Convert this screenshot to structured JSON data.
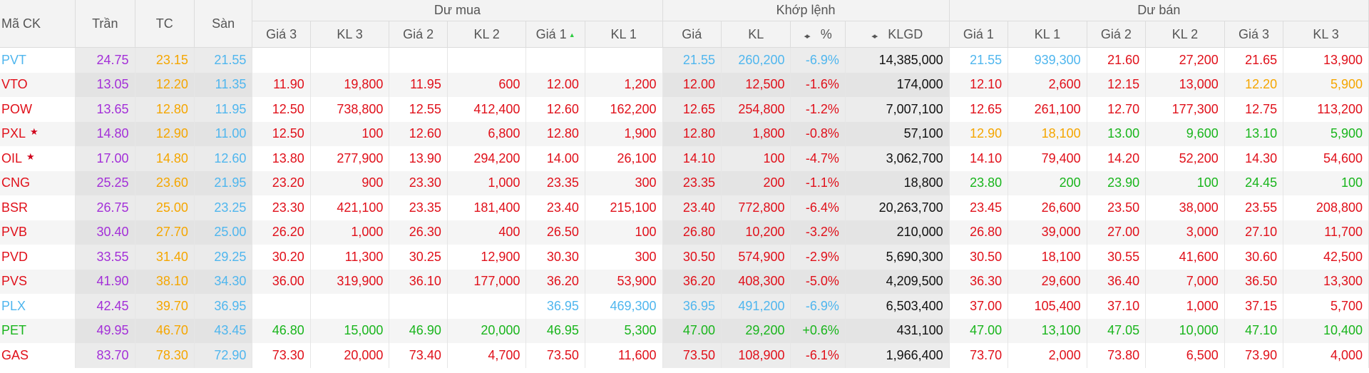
{
  "colors": {
    "ceil": "#a32fd8",
    "ref": "#f5a600",
    "floor": "#4fb6ee",
    "down": "#e0101a",
    "up": "#19b51c",
    "neutral": "#111111"
  },
  "icons": {
    "sort": "sort-up-triangle-icon",
    "toggle": "left-right-arrows-icon",
    "star": "star-icon"
  },
  "header": {
    "symbol": "Mã CK",
    "ceil": "Trần",
    "ref": "TC",
    "floor": "Sàn",
    "buy_group": "Dư mua",
    "match_group": "Khớp lệnh",
    "sell_group": "Dư bán",
    "buy_p3": "Giá 3",
    "buy_v3": "KL 3",
    "buy_p2": "Giá 2",
    "buy_v2": "KL 2",
    "buy_p1": "Giá 1",
    "buy_v1": "KL 1",
    "m_price": "Giá",
    "m_vol": "KL",
    "m_pct": "%",
    "m_total": "KLGD",
    "sell_p1": "Giá 1",
    "sell_v1": "KL 1",
    "sell_p2": "Giá 2",
    "sell_v2": "KL 2",
    "sell_p3": "Giá 3",
    "sell_v3": "KL 3"
  },
  "rows": [
    {
      "sym": "PVT",
      "symc": "blue",
      "star": false,
      "ceil": "24.75",
      "ref": "23.15",
      "floor": "21.55",
      "bp3": "",
      "bp3c": "red",
      "bv3": "",
      "bp2": "",
      "bp2c": "red",
      "bv2": "",
      "bp1": "",
      "bp1c": "red",
      "bv1": "",
      "mp": "21.55",
      "mpc": "blue",
      "mv": "260,200",
      "pct": "-6.9%",
      "total": "14,385,000",
      "sp1": "21.55",
      "sp1c": "blue",
      "sv1": "939,300",
      "sp2": "21.60",
      "sp2c": "red",
      "sv2": "27,200",
      "sp3": "21.65",
      "sp3c": "red",
      "sv3": "13,900"
    },
    {
      "sym": "VTO",
      "symc": "red",
      "star": false,
      "ceil": "13.05",
      "ref": "12.20",
      "floor": "11.35",
      "bp3": "11.90",
      "bp3c": "red",
      "bv3": "19,800",
      "bp2": "11.95",
      "bp2c": "red",
      "bv2": "600",
      "bp1": "12.00",
      "bp1c": "red",
      "bv1": "1,200",
      "mp": "12.00",
      "mpc": "red",
      "mv": "12,500",
      "pct": "-1.6%",
      "total": "174,000",
      "sp1": "12.10",
      "sp1c": "red",
      "sv1": "2,600",
      "sp2": "12.15",
      "sp2c": "red",
      "sv2": "13,000",
      "sp3": "12.20",
      "sp3c": "yellow",
      "sv3": "5,900"
    },
    {
      "sym": "POW",
      "symc": "red",
      "star": false,
      "ceil": "13.65",
      "ref": "12.80",
      "floor": "11.95",
      "bp3": "12.50",
      "bp3c": "red",
      "bv3": "738,800",
      "bp2": "12.55",
      "bp2c": "red",
      "bv2": "412,400",
      "bp1": "12.60",
      "bp1c": "red",
      "bv1": "162,200",
      "mp": "12.65",
      "mpc": "red",
      "mv": "254,800",
      "pct": "-1.2%",
      "total": "7,007,100",
      "sp1": "12.65",
      "sp1c": "red",
      "sv1": "261,100",
      "sp2": "12.70",
      "sp2c": "red",
      "sv2": "177,300",
      "sp3": "12.75",
      "sp3c": "red",
      "sv3": "113,200"
    },
    {
      "sym": "PXL",
      "symc": "red",
      "star": true,
      "ceil": "14.80",
      "ref": "12.90",
      "floor": "11.00",
      "bp3": "12.50",
      "bp3c": "red",
      "bv3": "100",
      "bp2": "12.60",
      "bp2c": "red",
      "bv2": "6,800",
      "bp1": "12.80",
      "bp1c": "red",
      "bv1": "1,900",
      "mp": "12.80",
      "mpc": "red",
      "mv": "1,800",
      "pct": "-0.8%",
      "total": "57,100",
      "sp1": "12.90",
      "sp1c": "yellow",
      "sv1": "18,100",
      "sp2": "13.00",
      "sp2c": "green",
      "sv2": "9,600",
      "sp3": "13.10",
      "sp3c": "green",
      "sv3": "5,900"
    },
    {
      "sym": "OIL",
      "symc": "red",
      "star": true,
      "ceil": "17.00",
      "ref": "14.80",
      "floor": "12.60",
      "bp3": "13.80",
      "bp3c": "red",
      "bv3": "277,900",
      "bp2": "13.90",
      "bp2c": "red",
      "bv2": "294,200",
      "bp1": "14.00",
      "bp1c": "red",
      "bv1": "26,100",
      "mp": "14.10",
      "mpc": "red",
      "mv": "100",
      "pct": "-4.7%",
      "total": "3,062,700",
      "sp1": "14.10",
      "sp1c": "red",
      "sv1": "79,400",
      "sp2": "14.20",
      "sp2c": "red",
      "sv2": "52,200",
      "sp3": "14.30",
      "sp3c": "red",
      "sv3": "54,600"
    },
    {
      "sym": "CNG",
      "symc": "red",
      "star": false,
      "ceil": "25.25",
      "ref": "23.60",
      "floor": "21.95",
      "bp3": "23.20",
      "bp3c": "red",
      "bv3": "900",
      "bp2": "23.30",
      "bp2c": "red",
      "bv2": "1,000",
      "bp1": "23.35",
      "bp1c": "red",
      "bv1": "300",
      "mp": "23.35",
      "mpc": "red",
      "mv": "200",
      "pct": "-1.1%",
      "total": "18,800",
      "sp1": "23.80",
      "sp1c": "green",
      "sv1": "200",
      "sp2": "23.90",
      "sp2c": "green",
      "sv2": "100",
      "sp3": "24.45",
      "sp3c": "green",
      "sv3": "100"
    },
    {
      "sym": "BSR",
      "symc": "red",
      "star": false,
      "ceil": "26.75",
      "ref": "25.00",
      "floor": "23.25",
      "bp3": "23.30",
      "bp3c": "red",
      "bv3": "421,100",
      "bp2": "23.35",
      "bp2c": "red",
      "bv2": "181,400",
      "bp1": "23.40",
      "bp1c": "red",
      "bv1": "215,100",
      "mp": "23.40",
      "mpc": "red",
      "mv": "772,800",
      "pct": "-6.4%",
      "total": "20,263,700",
      "sp1": "23.45",
      "sp1c": "red",
      "sv1": "26,600",
      "sp2": "23.50",
      "sp2c": "red",
      "sv2": "38,000",
      "sp3": "23.55",
      "sp3c": "red",
      "sv3": "208,800"
    },
    {
      "sym": "PVB",
      "symc": "red",
      "star": false,
      "ceil": "30.40",
      "ref": "27.70",
      "floor": "25.00",
      "bp3": "26.20",
      "bp3c": "red",
      "bv3": "1,000",
      "bp2": "26.30",
      "bp2c": "red",
      "bv2": "400",
      "bp1": "26.50",
      "bp1c": "red",
      "bv1": "100",
      "mp": "26.80",
      "mpc": "red",
      "mv": "10,200",
      "pct": "-3.2%",
      "total": "210,000",
      "sp1": "26.80",
      "sp1c": "red",
      "sv1": "39,000",
      "sp2": "27.00",
      "sp2c": "red",
      "sv2": "3,000",
      "sp3": "27.10",
      "sp3c": "red",
      "sv3": "11,700"
    },
    {
      "sym": "PVD",
      "symc": "red",
      "star": false,
      "ceil": "33.55",
      "ref": "31.40",
      "floor": "29.25",
      "bp3": "30.20",
      "bp3c": "red",
      "bv3": "11,300",
      "bp2": "30.25",
      "bp2c": "red",
      "bv2": "12,900",
      "bp1": "30.30",
      "bp1c": "red",
      "bv1": "300",
      "mp": "30.50",
      "mpc": "red",
      "mv": "574,900",
      "pct": "-2.9%",
      "total": "5,690,300",
      "sp1": "30.50",
      "sp1c": "red",
      "sv1": "18,100",
      "sp2": "30.55",
      "sp2c": "red",
      "sv2": "41,600",
      "sp3": "30.60",
      "sp3c": "red",
      "sv3": "42,500"
    },
    {
      "sym": "PVS",
      "symc": "red",
      "star": false,
      "ceil": "41.90",
      "ref": "38.10",
      "floor": "34.30",
      "bp3": "36.00",
      "bp3c": "red",
      "bv3": "319,900",
      "bp2": "36.10",
      "bp2c": "red",
      "bv2": "177,000",
      "bp1": "36.20",
      "bp1c": "red",
      "bv1": "53,900",
      "mp": "36.20",
      "mpc": "red",
      "mv": "408,300",
      "pct": "-5.0%",
      "total": "4,209,500",
      "sp1": "36.30",
      "sp1c": "red",
      "sv1": "29,600",
      "sp2": "36.40",
      "sp2c": "red",
      "sv2": "7,000",
      "sp3": "36.50",
      "sp3c": "red",
      "sv3": "13,300"
    },
    {
      "sym": "PLX",
      "symc": "blue",
      "star": false,
      "ceil": "42.45",
      "ref": "39.70",
      "floor": "36.95",
      "bp3": "",
      "bp3c": "red",
      "bv3": "",
      "bp2": "",
      "bp2c": "red",
      "bv2": "",
      "bp1": "36.95",
      "bp1c": "blue",
      "bv1": "469,300",
      "mp": "36.95",
      "mpc": "blue",
      "mv": "491,200",
      "pct": "-6.9%",
      "total": "6,503,400",
      "sp1": "37.00",
      "sp1c": "red",
      "sv1": "105,400",
      "sp2": "37.10",
      "sp2c": "red",
      "sv2": "1,000",
      "sp3": "37.15",
      "sp3c": "red",
      "sv3": "5,700"
    },
    {
      "sym": "PET",
      "symc": "green",
      "star": false,
      "ceil": "49.95",
      "ref": "46.70",
      "floor": "43.45",
      "bp3": "46.80",
      "bp3c": "green",
      "bv3": "15,000",
      "bp2": "46.90",
      "bp2c": "green",
      "bv2": "20,000",
      "bp1": "46.95",
      "bp1c": "green",
      "bv1": "5,300",
      "mp": "47.00",
      "mpc": "green",
      "mv": "29,200",
      "pct": "+0.6%",
      "total": "431,100",
      "sp1": "47.00",
      "sp1c": "green",
      "sv1": "13,100",
      "sp2": "47.05",
      "sp2c": "green",
      "sv2": "10,000",
      "sp3": "47.10",
      "sp3c": "green",
      "sv3": "10,400"
    },
    {
      "sym": "GAS",
      "symc": "red",
      "star": false,
      "ceil": "83.70",
      "ref": "78.30",
      "floor": "72.90",
      "bp3": "73.30",
      "bp3c": "red",
      "bv3": "20,000",
      "bp2": "73.40",
      "bp2c": "red",
      "bv2": "4,700",
      "bp1": "73.50",
      "bp1c": "red",
      "bv1": "11,600",
      "mp": "73.50",
      "mpc": "red",
      "mv": "108,900",
      "pct": "-6.1%",
      "total": "1,966,400",
      "sp1": "73.70",
      "sp1c": "red",
      "sv1": "2,000",
      "sp2": "73.80",
      "sp2c": "red",
      "sv2": "6,500",
      "sp3": "73.90",
      "sp3c": "red",
      "sv3": "4,000"
    }
  ]
}
